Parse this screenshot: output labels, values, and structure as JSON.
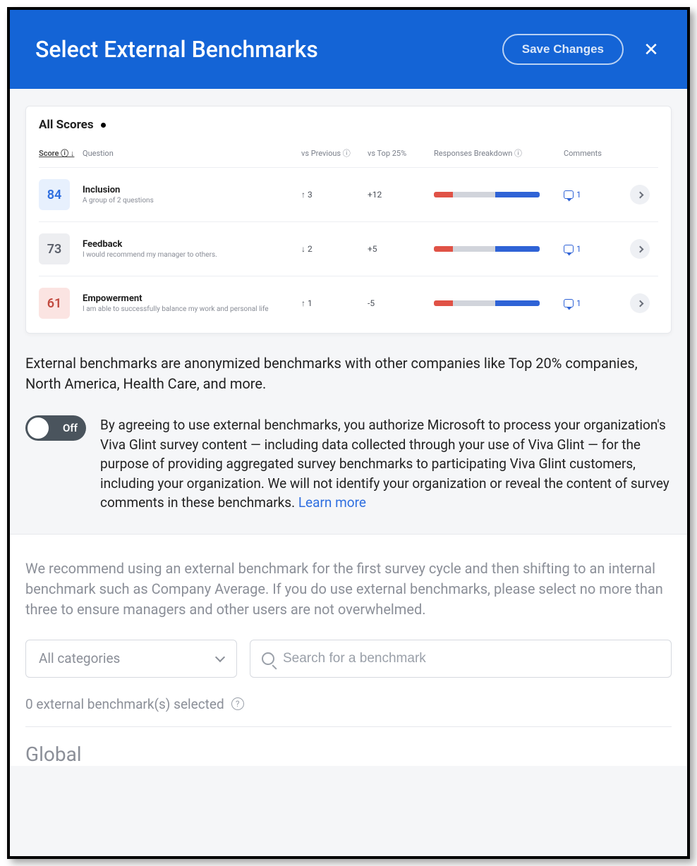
{
  "header": {
    "title": "Select External Benchmarks",
    "save_label": "Save Changes"
  },
  "scorecard": {
    "title": "All Scores",
    "columns": {
      "score": "Score ⓘ ↓",
      "question": "Question",
      "vs_previous": "vs Previous ⓘ",
      "vs_top25": "vs Top 25%",
      "responses": "Responses Breakdown ⓘ",
      "comments": "Comments"
    },
    "rows": [
      {
        "score": "84",
        "score_class": "score-blue",
        "title": "Inclusion",
        "subtitle": "A group of 2 questions",
        "vs_previous": "↑ 3",
        "vs_top25": "+12",
        "breakdown": {
          "red": 18,
          "grey": 40,
          "blue": 42
        },
        "comments": "1"
      },
      {
        "score": "73",
        "score_class": "score-grey",
        "title": "Feedback",
        "subtitle": "I would recommend my manager to others.",
        "vs_previous": "↓ 2",
        "vs_top25": "+5",
        "breakdown": {
          "red": 18,
          "grey": 40,
          "blue": 42
        },
        "comments": "1"
      },
      {
        "score": "61",
        "score_class": "score-red",
        "title": "Empowerment",
        "subtitle": "I am able to successfully balance my work and personal life",
        "vs_previous": "↑ 1",
        "vs_top25": "-5",
        "breakdown": {
          "red": 18,
          "grey": 40,
          "blue": 42
        },
        "comments": "1"
      }
    ]
  },
  "intro": "External benchmarks are anonymized benchmarks with other companies like Top 20% companies, North America, Health Care, and more.",
  "toggle": {
    "label": "Off",
    "state": "off"
  },
  "consent": "By agreeing to use external benchmarks, you authorize Microsoft to process your organization's Viva Glint survey content — including data collected through your use of Viva Glint — for the purpose of providing aggregated survey benchmarks to participating Viva Glint customers, including your organization. We will not identify your organization or reveal the content of survey comments in these benchmarks. ",
  "consent_link": "Learn more",
  "recommendation": "We recommend using an external benchmark for the first survey cycle and then shifting to an internal benchmark such as Company Average. If you do use external benchmarks, please select no more than three to ensure managers and other users are not overwhelmed.",
  "filters": {
    "category_label": "All categories",
    "search_placeholder": "Search for a benchmark"
  },
  "selected_text": "0 external benchmark(s) selected",
  "group_heading": "Global"
}
